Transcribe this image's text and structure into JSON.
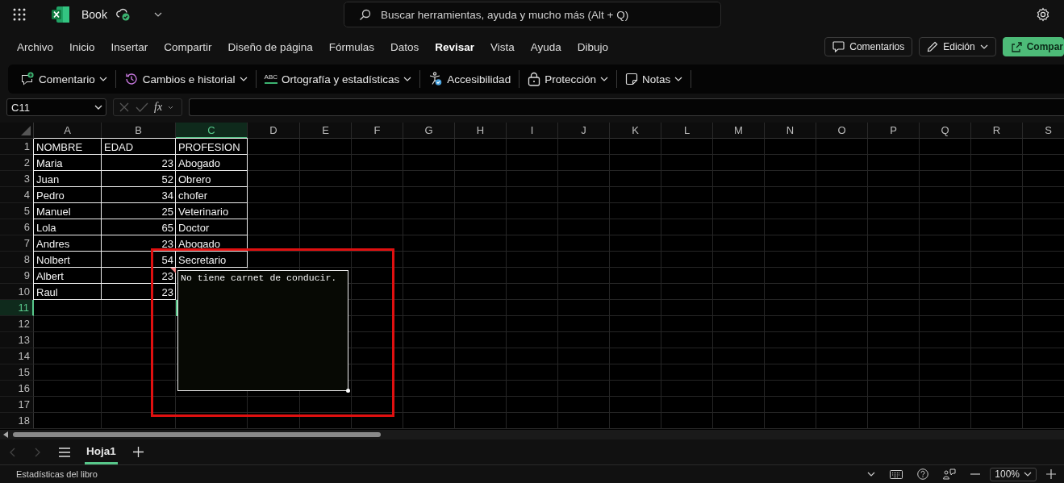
{
  "top_bar": {
    "doc_title": "Book",
    "search": {
      "placeholder": "Buscar herramientas, ayuda y mucho más (Alt + Q)"
    }
  },
  "ribbon_tabs": [
    {
      "label": "Archivo",
      "selected": false
    },
    {
      "label": "Inicio",
      "selected": false
    },
    {
      "label": "Insertar",
      "selected": false
    },
    {
      "label": "Compartir",
      "selected": false
    },
    {
      "label": "Diseño de página",
      "selected": false
    },
    {
      "label": "Fórmulas",
      "selected": false
    },
    {
      "label": "Datos",
      "selected": false
    },
    {
      "label": "Revisar",
      "selected": true
    },
    {
      "label": "Vista",
      "selected": false
    },
    {
      "label": "Ayuda",
      "selected": false
    },
    {
      "label": "Dibujo",
      "selected": false
    }
  ],
  "header_buttons": [
    {
      "label": "Comentarios",
      "kind": "comments"
    },
    {
      "label": "Edición",
      "kind": "editing"
    },
    {
      "label": "Compar",
      "kind": "share"
    }
  ],
  "toolbar": [
    {
      "label": "Comentario",
      "kind": "comment"
    },
    {
      "label": "Cambios e historial",
      "kind": "history"
    },
    {
      "label": "Ortografía y estadísticas",
      "kind": "spelling",
      "icon_text": "ABC"
    },
    {
      "label": "Accesibilidad",
      "kind": "accessibility"
    },
    {
      "label": "Protección",
      "kind": "protection"
    },
    {
      "label": "Notas",
      "kind": "notes"
    }
  ],
  "formula_bar": {
    "name_box": "C11",
    "function_label": "fx"
  },
  "columns": [
    {
      "label": "A",
      "selected": false
    },
    {
      "label": "B",
      "selected": false
    },
    {
      "label": "C",
      "selected": true
    },
    {
      "label": "D",
      "selected": false
    },
    {
      "label": "E",
      "selected": false
    },
    {
      "label": "F",
      "selected": false
    },
    {
      "label": "G",
      "selected": false
    },
    {
      "label": "H",
      "selected": false
    },
    {
      "label": "I",
      "selected": false
    },
    {
      "label": "J",
      "selected": false
    },
    {
      "label": "K",
      "selected": false
    },
    {
      "label": "L",
      "selected": false
    },
    {
      "label": "M",
      "selected": false
    },
    {
      "label": "N",
      "selected": false
    },
    {
      "label": "O",
      "selected": false
    },
    {
      "label": "P",
      "selected": false
    },
    {
      "label": "Q",
      "selected": false
    },
    {
      "label": "R",
      "selected": false
    },
    {
      "label": "S",
      "selected": false
    }
  ],
  "rows": [
    {
      "number": "1",
      "selected": false,
      "cells": [
        {
          "text": "NOMBRE",
          "kind": "text",
          "comment": false
        },
        {
          "text": "EDAD",
          "kind": "text",
          "comment": false
        },
        {
          "text": "PROFESION",
          "kind": "text",
          "comment": false
        }
      ]
    },
    {
      "number": "2",
      "selected": false,
      "cells": [
        {
          "text": "Maria",
          "kind": "text",
          "comment": false
        },
        {
          "text": "23",
          "kind": "number",
          "comment": false
        },
        {
          "text": "Abogado",
          "kind": "text",
          "comment": false
        }
      ]
    },
    {
      "number": "3",
      "selected": false,
      "cells": [
        {
          "text": "Juan",
          "kind": "text",
          "comment": false
        },
        {
          "text": "52",
          "kind": "number",
          "comment": false
        },
        {
          "text": "Obrero",
          "kind": "text",
          "comment": false
        }
      ]
    },
    {
      "number": "4",
      "selected": false,
      "cells": [
        {
          "text": "Pedro",
          "kind": "text",
          "comment": false
        },
        {
          "text": "34",
          "kind": "number",
          "comment": false
        },
        {
          "text": "chofer",
          "kind": "text",
          "comment": false
        }
      ]
    },
    {
      "number": "5",
      "selected": false,
      "cells": [
        {
          "text": "Manuel",
          "kind": "text",
          "comment": false
        },
        {
          "text": "25",
          "kind": "number",
          "comment": false
        },
        {
          "text": "Veterinario",
          "kind": "text",
          "comment": false
        }
      ]
    },
    {
      "number": "6",
      "selected": false,
      "cells": [
        {
          "text": "Lola",
          "kind": "text",
          "comment": false
        },
        {
          "text": "65",
          "kind": "number",
          "comment": false
        },
        {
          "text": "Doctor",
          "kind": "text",
          "comment": false
        }
      ]
    },
    {
      "number": "7",
      "selected": false,
      "cells": [
        {
          "text": "Andres",
          "kind": "text",
          "comment": false
        },
        {
          "text": "23",
          "kind": "number",
          "comment": false
        },
        {
          "text": "Abogado",
          "kind": "text",
          "comment": false
        }
      ]
    },
    {
      "number": "8",
      "selected": false,
      "cells": [
        {
          "text": "Nolbert",
          "kind": "text",
          "comment": false
        },
        {
          "text": "54",
          "kind": "number",
          "comment": false
        },
        {
          "text": "Secretario",
          "kind": "text",
          "comment": false
        }
      ]
    },
    {
      "number": "9",
      "selected": false,
      "cells": [
        {
          "text": "Albert",
          "kind": "text",
          "comment": false
        },
        {
          "text": "23",
          "kind": "number",
          "comment": true
        }
      ]
    },
    {
      "number": "10",
      "selected": false,
      "cells": [
        {
          "text": "Raul",
          "kind": "text",
          "comment": false
        },
        {
          "text": "23",
          "kind": "number",
          "comment": false
        }
      ]
    },
    {
      "number": "11",
      "selected": true,
      "cells": []
    },
    {
      "number": "12",
      "selected": false,
      "cells": []
    },
    {
      "number": "13",
      "selected": false,
      "cells": []
    },
    {
      "number": "14",
      "selected": false,
      "cells": []
    },
    {
      "number": "15",
      "selected": false,
      "cells": []
    },
    {
      "number": "16",
      "selected": false,
      "cells": []
    },
    {
      "number": "17",
      "selected": false,
      "cells": []
    },
    {
      "number": "18",
      "selected": false,
      "cells": []
    }
  ],
  "note": {
    "text": "No tiene carnet de conducir."
  },
  "sheet_tabs": [
    {
      "label": "Hoja1",
      "selected": true
    }
  ],
  "status_bar": {
    "label": "Estadísticas del libro",
    "zoom": "100%"
  }
}
